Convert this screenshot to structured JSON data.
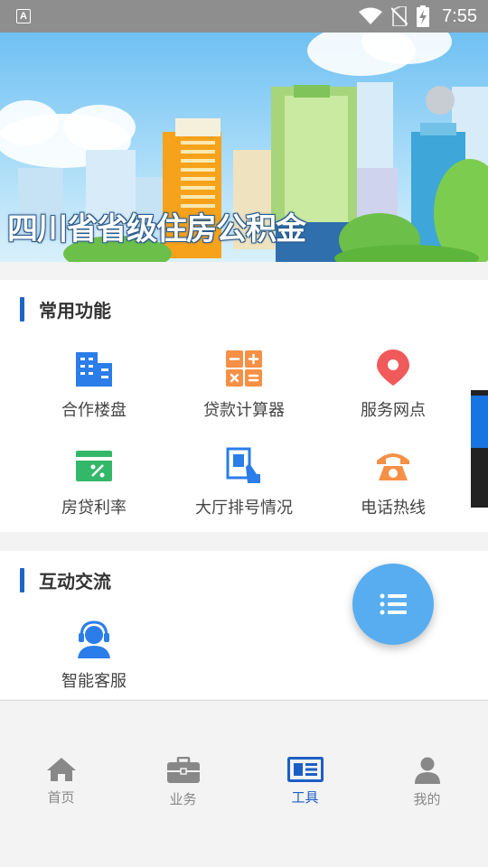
{
  "status_bar": {
    "time": "7:55",
    "notification_icon": "a-letter-icon"
  },
  "banner": {
    "title": "四川省省级住房公积金"
  },
  "common_functions": {
    "title": "常用功能",
    "items": [
      {
        "label": "合作楼盘",
        "icon": "building-icon",
        "color": "#2b7de9"
      },
      {
        "label": "贷款计算器",
        "icon": "calculator-icon",
        "color": "#f59046"
      },
      {
        "label": "服务网点",
        "icon": "location-pin-icon",
        "color": "#f05a5a"
      },
      {
        "label": "房贷利率",
        "icon": "rate-card-icon",
        "color": "#33b86a"
      },
      {
        "label": "大厅排号情况",
        "icon": "queue-ticket-icon",
        "color": "#2b7de9"
      },
      {
        "label": "电话热线",
        "icon": "phone-icon",
        "color": "#f59046"
      }
    ]
  },
  "interactive": {
    "title": "互动交流",
    "items": [
      {
        "label": "智能客服",
        "icon": "customer-service-icon",
        "color": "#2b7de9"
      }
    ]
  },
  "fab": {
    "icon": "list-menu-icon",
    "color": "#58adf0"
  },
  "bottom_nav": {
    "items": [
      {
        "label": "首页",
        "icon": "home-icon"
      },
      {
        "label": "业务",
        "icon": "briefcase-icon"
      },
      {
        "label": "工具",
        "icon": "newspaper-icon",
        "active": true
      },
      {
        "label": "我的",
        "icon": "user-icon"
      }
    ],
    "active_color": "#1c5fc4",
    "inactive_color": "#888888"
  }
}
